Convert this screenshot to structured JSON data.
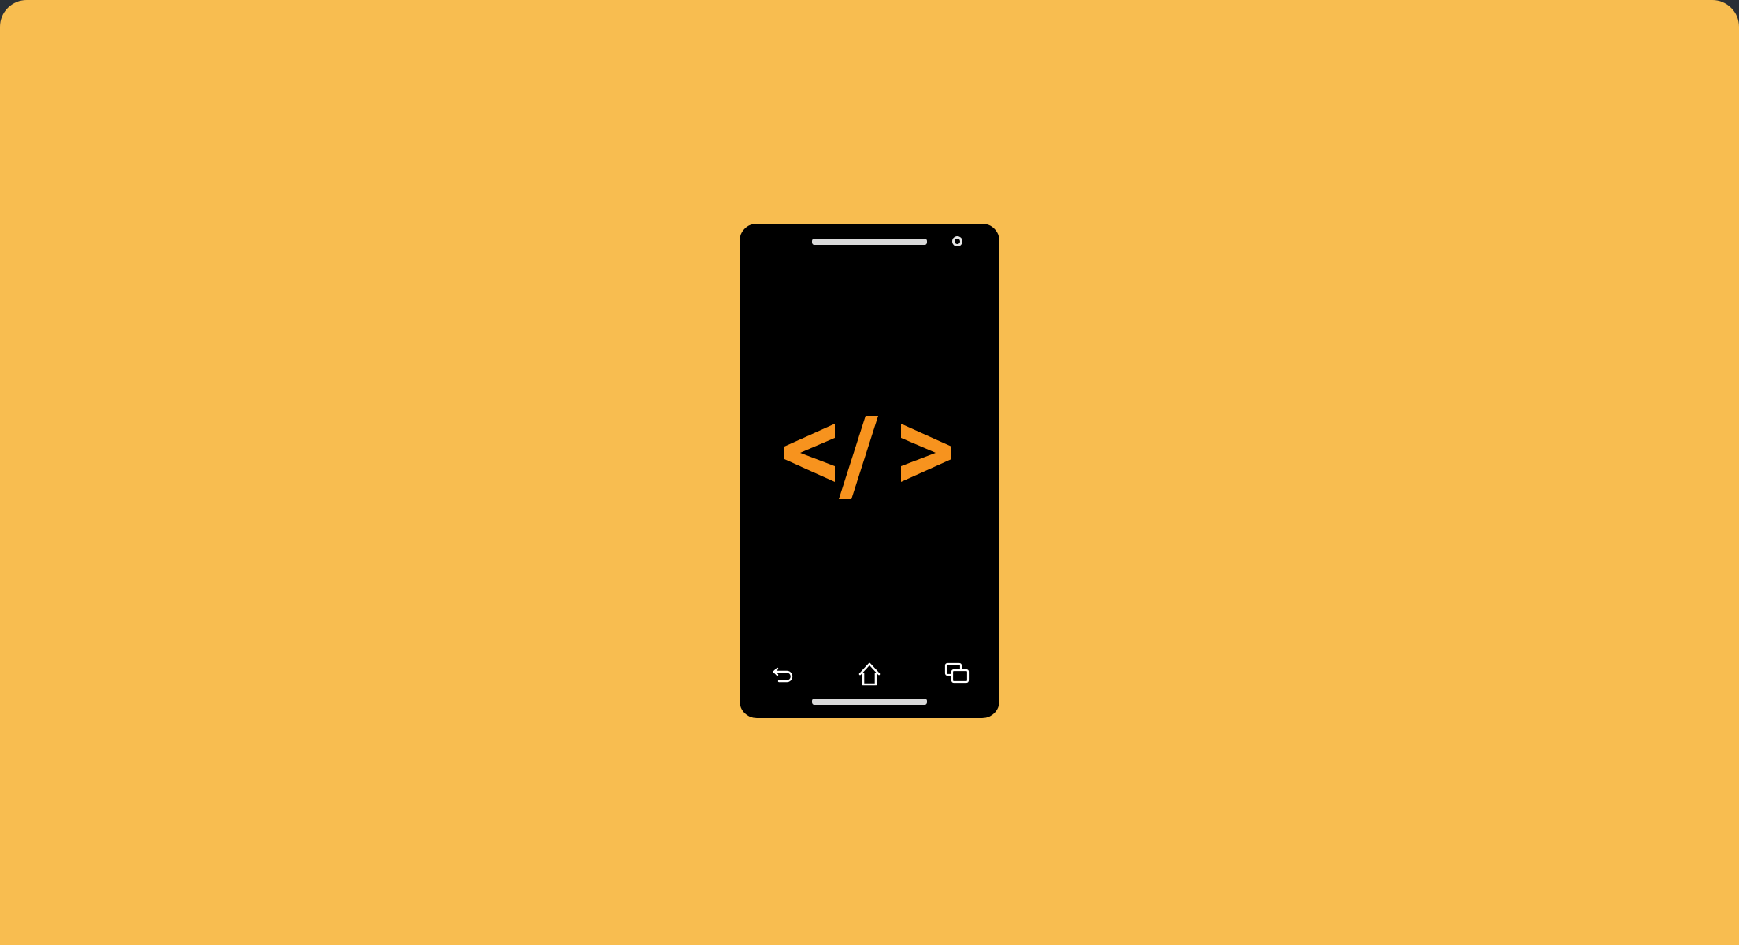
{
  "colors": {
    "background": "#f8bd50",
    "device": "#000000",
    "accent": "#f7931e",
    "detail": "#d9d9d9"
  },
  "device": {
    "type": "smartphone",
    "screen_icon": "code-brackets-icon",
    "nav_icons": [
      "back-icon",
      "home-icon",
      "recent-apps-icon"
    ]
  }
}
